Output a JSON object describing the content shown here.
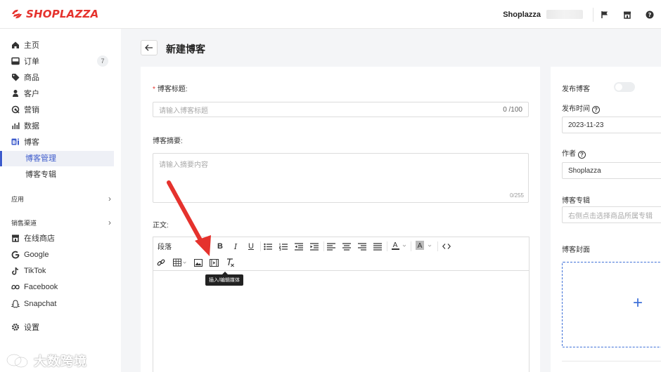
{
  "brand": {
    "name": "SHOPLAZZA",
    "color": "#e5322d"
  },
  "header": {
    "store_name": "Shoplazza",
    "icons": [
      "flag-icon",
      "store-icon",
      "help-icon"
    ]
  },
  "sidebar": {
    "items": [
      {
        "label": "主页",
        "icon": "home-icon"
      },
      {
        "label": "订单",
        "icon": "order-icon",
        "badge": "7"
      },
      {
        "label": "商品",
        "icon": "tag-icon"
      },
      {
        "label": "客户",
        "icon": "user-icon"
      },
      {
        "label": "营销",
        "icon": "marketing-icon"
      },
      {
        "label": "数据",
        "icon": "chart-icon"
      },
      {
        "label": "博客",
        "icon": "blog-icon"
      }
    ],
    "blog_sub": [
      {
        "label": "博客管理",
        "active": true
      },
      {
        "label": "博客专辑",
        "active": false
      }
    ],
    "apps_label": "应用",
    "channels_label": "销售渠道",
    "channels": [
      {
        "label": "在线商店",
        "icon": "store-icon"
      },
      {
        "label": "Google",
        "icon": "google-icon"
      },
      {
        "label": "TikTok",
        "icon": "tiktok-icon"
      },
      {
        "label": "Facebook",
        "icon": "meta-icon"
      },
      {
        "label": "Snapchat",
        "icon": "snapchat-icon"
      }
    ],
    "settings_label": "设置",
    "accent": "#3d5bcc"
  },
  "page": {
    "title": "新建博客"
  },
  "form": {
    "title_label": "博客标题:",
    "title_placeholder": "请输入博客标题",
    "title_counter": "0 /100",
    "summary_label": "博客摘要:",
    "summary_placeholder": "请输入摘要内容",
    "summary_counter": "0/255",
    "body_label": "正文:",
    "paragraph_select": "段落",
    "tooltip": "插入/编辑媒体"
  },
  "side": {
    "publish_label": "发布博客",
    "publish_enabled": false,
    "publish_time_label": "发布时间",
    "publish_date": "2023-11-23",
    "author_label": "作者",
    "author_value": "Shoplazza",
    "album_label": "博客专辑",
    "album_placeholder": "右侧点击选择商品所属专辑",
    "cover_label": "博客封面"
  },
  "watermark": "大数跨境"
}
